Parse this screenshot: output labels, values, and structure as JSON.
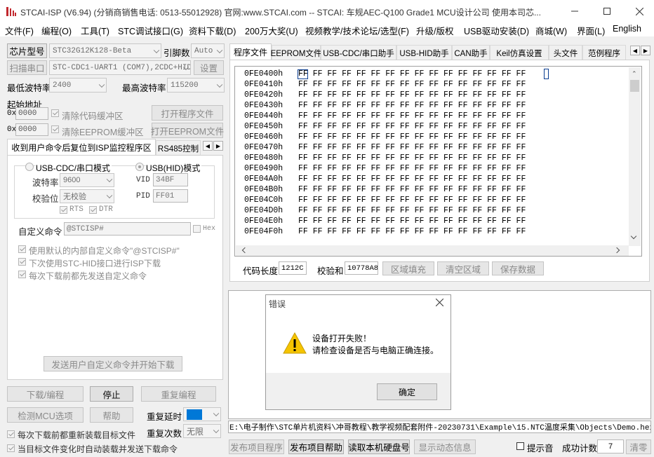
{
  "window": {
    "title": "STCAI-ISP (V6.94) (分销商销售电话: 0513-55012928) 官网:www.STCAI.com  -- STCAI: 车规AEC-Q100 Grade1 MCU设计公司 使用本司芯..."
  },
  "menu": [
    "文件(F)",
    "编程(O)",
    "工具(T)",
    "STC调试接口(G)",
    "资料下载(D)",
    "200万大奖(U)",
    "视频教学/技术论坛/选型(F)",
    "升级/版权",
    "USB驱动安装(D)",
    "商城(W)",
    "界面(L)",
    "English"
  ],
  "left": {
    "chip_type_btn": "芯片型号",
    "chip_value": "STC32G12K128-Beta",
    "pin_label": "引脚数",
    "pin_value": "Auto",
    "scan_port_btn": "扫描串口",
    "port_value": "STC-CDC1-UART1 (COM7),2CDC+HID",
    "settings_btn": "设置",
    "min_baud_label": "最低波特率",
    "min_baud_value": "2400",
    "max_baud_label": "最高波特率",
    "max_baud_value": "115200",
    "start_addr_label": "起始地址",
    "addr1_prefix": "0x",
    "addr1_value": "0000",
    "addr2_prefix": "0x",
    "addr2_value": "0000",
    "clear_code_label": "清除代码缓冲区",
    "clear_eeprom_label": "清除EEPROM缓冲区",
    "open_prog_btn": "打开程序文件",
    "open_eeprom_btn": "打开EEPROM文件"
  },
  "subtabs": [
    "收到用户命令后复位到ISP监控程序区",
    "RS485控制"
  ],
  "panel": {
    "usb_cdc_label": "USB-CDC/串口模式",
    "usb_hid_label": "USB(HID)模式",
    "baud_label": "波特率",
    "baud_value": "9600",
    "parity_label": "校验位",
    "parity_value": "无校验",
    "rts_label": "RTS",
    "dtr_label": "DTR",
    "vid_label": "VID",
    "vid_value": "34BF",
    "pid_label": "PID",
    "pid_value": "FF01",
    "custom_cmd_label": "自定义命令",
    "custom_cmd_value": "@STCISP#",
    "hex_label": "Hex",
    "opt1": "使用默认的内部自定义命令\"@STCISP#\"",
    "opt2": "下次使用STC-HID接口进行ISP下载",
    "opt3": "每次下载前都先发送自定义命令",
    "send_btn": "发送用户自定义命令并开始下载"
  },
  "bottom_left": {
    "download_btn": "下载/编程",
    "stop_btn": "停止",
    "reprogram_btn": "重复编程",
    "check_mcu_btn": "检测MCU选项",
    "help_btn": "帮助",
    "repeat_delay_label": "重复延时",
    "repeat_delay_value": "1 秒",
    "repeat_count_label": "重复次数",
    "repeat_count_value": "无限",
    "reload_label": "每次下载前都重新装载目标文件",
    "auto_label": "当目标文件变化时自动装载并发送下载命令"
  },
  "main_tabs": [
    "程序文件",
    "EEPROM文件",
    "USB-CDC/串口助手",
    "USB-HID助手",
    "CAN助手",
    "Keil仿真设置",
    "头文件",
    "范例程序"
  ],
  "hex": {
    "rows": [
      {
        "addr": "0FE0400h",
        "bytes": "FF FF FF FF FF FF FF FF FF FF FF FF FF FF FF FF"
      },
      {
        "addr": "0FE0410h",
        "bytes": "FF FF FF FF FF FF FF FF FF FF FF FF FF FF FF FF"
      },
      {
        "addr": "0FE0420h",
        "bytes": "FF FF FF FF FF FF FF FF FF FF FF FF FF FF FF FF"
      },
      {
        "addr": "0FE0430h",
        "bytes": "FF FF FF FF FF FF FF FF FF FF FF FF FF FF FF FF"
      },
      {
        "addr": "0FE0440h",
        "bytes": "FF FF FF FF FF FF FF FF FF FF FF FF FF FF FF FF"
      },
      {
        "addr": "0FE0450h",
        "bytes": "FF FF FF FF FF FF FF FF FF FF FF FF FF FF FF FF"
      },
      {
        "addr": "0FE0460h",
        "bytes": "FF FF FF FF FF FF FF FF FF FF FF FF FF FF FF FF"
      },
      {
        "addr": "0FE0470h",
        "bytes": "FF FF FF FF FF FF FF FF FF FF FF FF FF FF FF FF"
      },
      {
        "addr": "0FE0480h",
        "bytes": "FF FF FF FF FF FF FF FF FF FF FF FF FF FF FF FF"
      },
      {
        "addr": "0FE0490h",
        "bytes": "FF FF FF FF FF FF FF FF FF FF FF FF FF FF FF FF"
      },
      {
        "addr": "0FE04A0h",
        "bytes": "FF FF FF FF FF FF FF FF FF FF FF FF FF FF FF FF"
      },
      {
        "addr": "0FE04B0h",
        "bytes": "FF FF FF FF FF FF FF FF FF FF FF FF FF FF FF FF"
      },
      {
        "addr": "0FE04C0h",
        "bytes": "FF FF FF FF FF FF FF FF FF FF FF FF FF FF FF FF"
      },
      {
        "addr": "0FE04D0h",
        "bytes": "FF FF FF FF FF FF FF FF FF FF FF FF FF FF FF FF"
      },
      {
        "addr": "0FE04E0h",
        "bytes": "FF FF FF FF FF FF FF FF FF FF FF FF FF FF FF FF"
      },
      {
        "addr": "0FE04F0h",
        "bytes": "FF FF FF FF FF FF FF FF FF FF FF FF FF FF FF FF"
      }
    ]
  },
  "code_bar": {
    "code_len_label": "代码长度",
    "code_len_value": "1212C",
    "checksum_label": "校验和",
    "checksum_value": "10778A8",
    "fill_btn": "区域填充",
    "clear_btn": "清空区域",
    "save_btn": "保存数据"
  },
  "dialog": {
    "title": "错误",
    "line1": "设备打开失败！",
    "line2": "请检查设备是否与电脑正确连接。",
    "ok_btn": "确定"
  },
  "path": "E:\\电子制作\\STC单片机资料\\冲哥教程\\教学视频配套附件-20230731\\Example\\15.NTC温度采集\\Objects\\Demo.hex",
  "status_bar": {
    "publish_btn": "发布项目程序",
    "publish_help_btn": "发布项目帮助",
    "read_disk_btn": "读取本机硬盘号",
    "dynamic_btn": "显示动态信息",
    "sound_label": "提示音",
    "success_label": "成功计数",
    "success_value": "7",
    "clear_btn": "清零"
  },
  "colors": {
    "accent": "#0078d7",
    "warning": "#f5c400",
    "icon_red": "#c1272d"
  }
}
